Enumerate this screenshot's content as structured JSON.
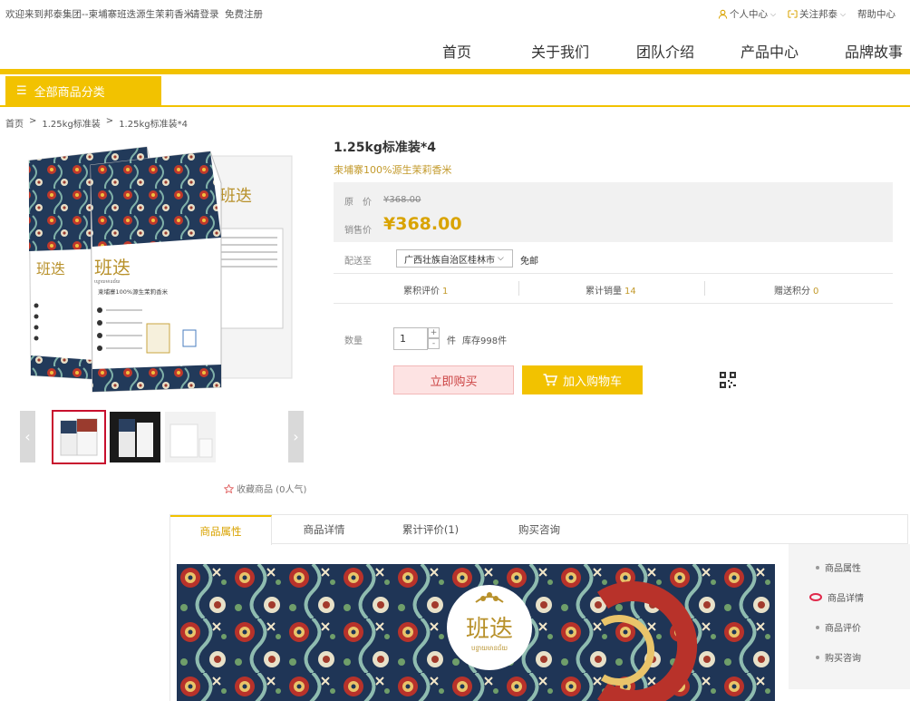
{
  "topbar": {
    "welcome": "欢迎来到邦泰集团--柬埔寨班迭源生茉莉香米",
    "login": "请登录",
    "register": "免费注册",
    "personal": "个人中心",
    "follow": "关注邦泰",
    "help": "帮助中心"
  },
  "nav": {
    "items": [
      "首页",
      "关于我们",
      "团队介绍",
      "产品中心",
      "品牌故事"
    ]
  },
  "category": {
    "label": "全部商品分类"
  },
  "breadcrumb": [
    "首页",
    ">",
    "1.25kg标准装",
    ">",
    "1.25kg标准装*4"
  ],
  "gallery": {
    "favorite": "收藏商品 (0人气)",
    "package_brand": "班迭",
    "package_brand_latin": "បន្ទាយមានជ័យ",
    "package_text": "柬埔寨100%源生茉莉香米"
  },
  "product": {
    "title": "1.25kg标准装*4",
    "subtitle": "柬埔寨100%源生茉莉香米",
    "original_label": "原　价",
    "original_price": "¥368.00",
    "sale_label": "销售价",
    "sale_price": "¥368.00",
    "ship_label": "配送至",
    "ship_region": "广西壮族自治区桂林市",
    "ship_fee": "免邮",
    "stats": [
      {
        "label": "累积评价",
        "value": "1"
      },
      {
        "label": "累计销量",
        "value": "14"
      },
      {
        "label": "赠送积分",
        "value": "0"
      }
    ],
    "qty_label": "数量",
    "qty_value": "1",
    "qty_unit": "件",
    "stock": "库存998件",
    "buy_now": "立即购买",
    "add_cart": "加入购物车"
  },
  "tabs": [
    "商品属性",
    "商品详情",
    "累计评价(1)",
    "购买咨询"
  ],
  "side_nav": [
    "商品属性",
    "商品详情",
    "商品评价",
    "购买咨询"
  ],
  "colors": {
    "accent": "#f2c200",
    "price": "#d9a300",
    "gold_text": "#c39a2b"
  }
}
